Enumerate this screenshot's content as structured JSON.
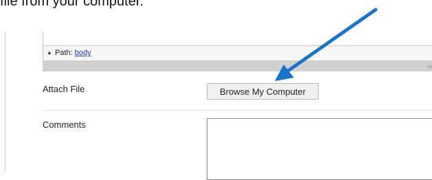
{
  "caption": {
    "text": "file from your computer."
  },
  "editor": {
    "path_label": "Path:",
    "path_link": "body",
    "grip": "="
  },
  "form": {
    "attach_label": "Attach File",
    "browse_button": "Browse My Computer",
    "comments_label": "Comments",
    "comments_value": ""
  },
  "annotation": {
    "arrow_color": "#1a73c8",
    "icon": "arrow-pointer-icon"
  }
}
